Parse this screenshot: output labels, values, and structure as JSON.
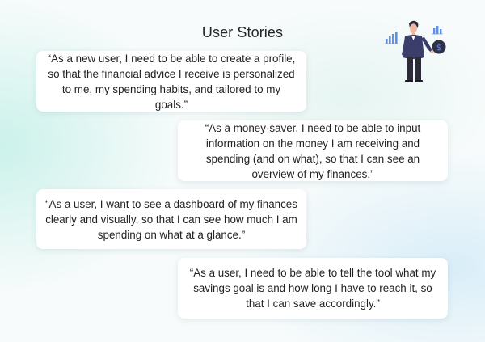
{
  "title": "User Stories",
  "stories": [
    "“As a new user, I need to be able to create a profile, so that the financial advice I receive is personalized to me, my spending habits, and tailored to my goals.”",
    "“As a money-saver, I need to be able to input information on the money I am receiving and spending (and on what), so that I can see an overview of my finances.”",
    "“As a user, I want to see a dashboard of my finances clearly and visually, so that I can see how much I am spending on what at a glance.”",
    "“As a user, I need to be able to tell the tool what my savings goal is and how long I have to reach it, so that I can save accordingly.”"
  ],
  "illustration": {
    "icons": [
      "bar-chart-icon",
      "person-figure",
      "dollar-coin-icon",
      "mini-chart-icon"
    ],
    "coin_symbol": "$",
    "colors": {
      "accent_blue": "#5b8ff0",
      "suit_navy": "#3b3d6b",
      "coin_dark": "#2f2f47",
      "skin": "#f2b5a0"
    }
  }
}
